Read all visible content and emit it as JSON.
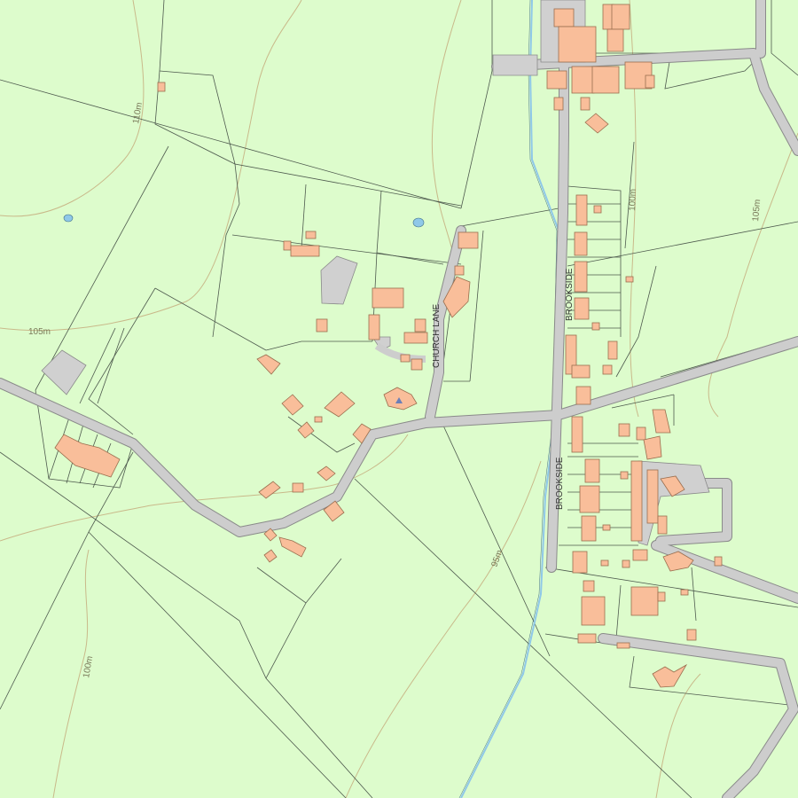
{
  "map": {
    "colors": {
      "land": "#ddfccc",
      "road": "#cdcdcd",
      "road_edge": "#8a8a8a",
      "building": "#f9be9a",
      "building_edge": "#9a6e4e",
      "field_boundary": "#4e5a4e",
      "contour": "#c9b98a",
      "water": "#8fc8e8",
      "paved_area": "#d0d0d0"
    },
    "road_labels": {
      "church_lane": "CHURCH LANE",
      "brookside_north": "BROOKSIDE",
      "brookside_south": "BROOKSIDE"
    },
    "contour_labels": {
      "c110": "110m",
      "c105_west": "105m",
      "c105_east": "105m",
      "c100_centre": "100m",
      "c100_south": "100m",
      "c95": "95m"
    },
    "icons": {
      "church": "church-symbol-icon"
    }
  }
}
